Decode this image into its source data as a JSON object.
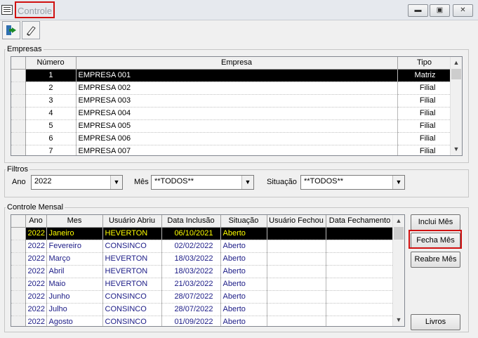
{
  "window": {
    "title": "Controle"
  },
  "toolbar": {
    "exit_icon": "exit-door-icon",
    "edit_icon": "eraser-icon"
  },
  "empresas": {
    "legend": "Empresas",
    "columns": [
      "Número",
      "Empresa",
      "Tipo"
    ],
    "rows": [
      {
        "numero": "1",
        "empresa": "EMPRESA 001",
        "tipo": "Matriz"
      },
      {
        "numero": "2",
        "empresa": "EMPRESA 002",
        "tipo": "Filial"
      },
      {
        "numero": "3",
        "empresa": "EMPRESA 003",
        "tipo": "Filial"
      },
      {
        "numero": "4",
        "empresa": "EMPRESA 004",
        "tipo": "Filial"
      },
      {
        "numero": "5",
        "empresa": "EMPRESA 005",
        "tipo": "Filial"
      },
      {
        "numero": "6",
        "empresa": "EMPRESA 006",
        "tipo": "Filial"
      },
      {
        "numero": "7",
        "empresa": "EMPRESA 007",
        "tipo": "Filial"
      }
    ]
  },
  "filtros": {
    "legend": "Filtros",
    "ano_label": "Ano",
    "ano_value": "2022",
    "mes_label": "Mês",
    "mes_value": "**TODOS**",
    "situacao_label": "Situação",
    "situacao_value": "**TODOS**"
  },
  "controle": {
    "legend": "Controle Mensal",
    "columns": [
      "Ano",
      "Mes",
      "Usuário Abriu",
      "Data Inclusão",
      "Situação",
      "Usuário Fechou",
      "Data Fechamento"
    ],
    "rows": [
      {
        "ano": "2022",
        "mes": "Janeiro",
        "usuario": "HEVERTON",
        "data": "06/10/2021",
        "situacao": "Aberto",
        "fechou": "",
        "data_fech": ""
      },
      {
        "ano": "2022",
        "mes": "Fevereiro",
        "usuario": "CONSINCO",
        "data": "02/02/2022",
        "situacao": "Aberto",
        "fechou": "",
        "data_fech": ""
      },
      {
        "ano": "2022",
        "mes": "Março",
        "usuario": "HEVERTON",
        "data": "18/03/2022",
        "situacao": "Aberto",
        "fechou": "",
        "data_fech": ""
      },
      {
        "ano": "2022",
        "mes": "Abril",
        "usuario": "HEVERTON",
        "data": "18/03/2022",
        "situacao": "Aberto",
        "fechou": "",
        "data_fech": ""
      },
      {
        "ano": "2022",
        "mes": "Maio",
        "usuario": "HEVERTON",
        "data": "21/03/2022",
        "situacao": "Aberto",
        "fechou": "",
        "data_fech": ""
      },
      {
        "ano": "2022",
        "mes": "Junho",
        "usuario": "CONSINCO",
        "data": "28/07/2022",
        "situacao": "Aberto",
        "fechou": "",
        "data_fech": ""
      },
      {
        "ano": "2022",
        "mes": "Julho",
        "usuario": "CONSINCO",
        "data": "28/07/2022",
        "situacao": "Aberto",
        "fechou": "",
        "data_fech": ""
      },
      {
        "ano": "2022",
        "mes": "Agosto",
        "usuario": "CONSINCO",
        "data": "01/09/2022",
        "situacao": "Aberto",
        "fechou": "",
        "data_fech": ""
      }
    ]
  },
  "buttons": {
    "inclui": "Inclui Mês",
    "fecha": "Fecha Mês",
    "reabre": "Reabre Mês",
    "livros": "Livros"
  }
}
